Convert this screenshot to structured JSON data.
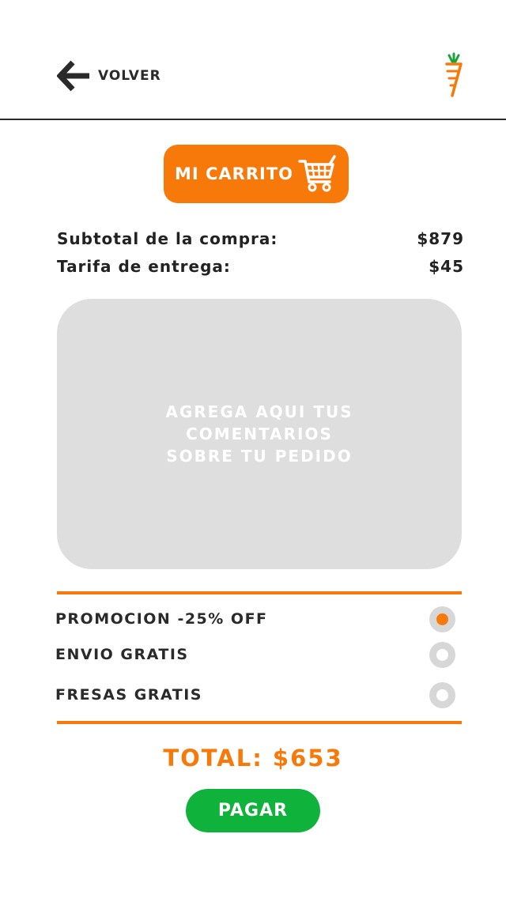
{
  "header": {
    "back_label": "VOLVER",
    "logo_icon": "carrot-icon"
  },
  "cart": {
    "title": "MI CARRITO",
    "icon": "shopping-cart-icon"
  },
  "summary": {
    "subtotal_label": "Subtotal de la compra:",
    "subtotal_value": "$879",
    "fee_label": "Tarifa de entrega:",
    "fee_value": "$45"
  },
  "comments": {
    "placeholder": "AGREGA AQUI TUS\nCOMENTARIOS\nSOBRE TU PEDIDO"
  },
  "promos": [
    {
      "label": "PROMOCION -25% OFF",
      "selected": true
    },
    {
      "label": "ENVIO GRATIS",
      "selected": false
    },
    {
      "label": "FRESAS GRATIS",
      "selected": false
    }
  ],
  "total": "TOTAL: $653",
  "pay_label": "PAGAR",
  "colors": {
    "accent": "#f7790a",
    "pay_green": "#0fb23a",
    "panel_gray": "#dedede"
  }
}
